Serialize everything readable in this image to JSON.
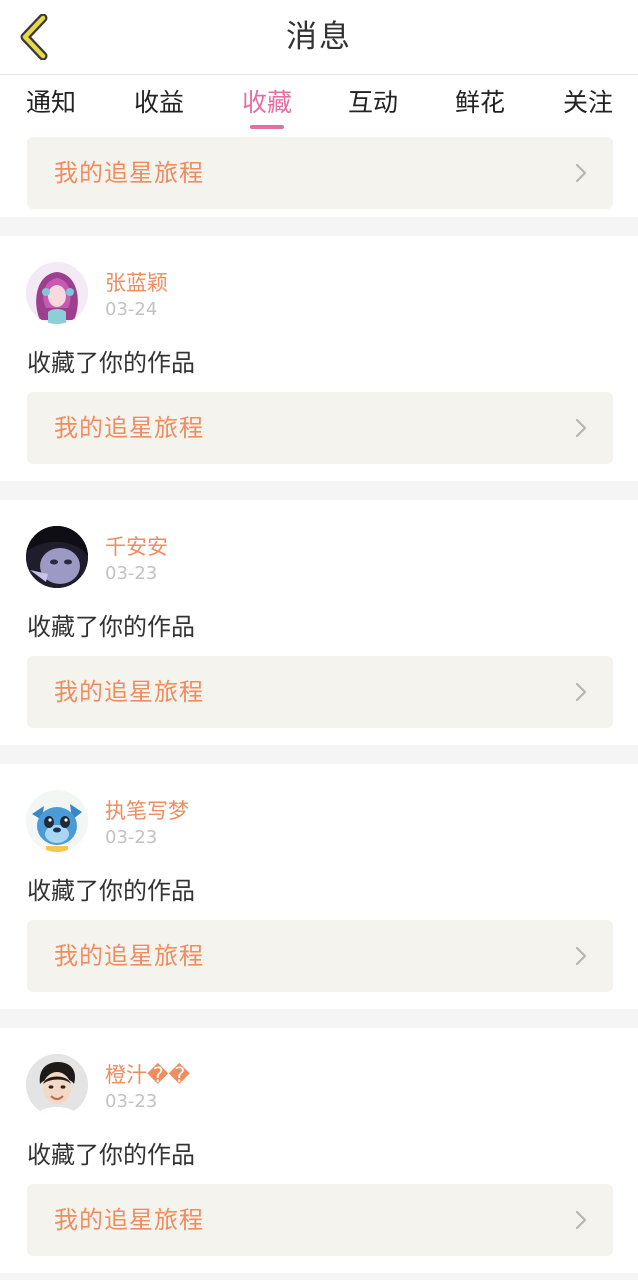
{
  "header": {
    "title": "消息",
    "back_icon": "chevron-left-icon",
    "accent_color": "#e8d94a"
  },
  "tabs": [
    {
      "label": "通知",
      "active": false
    },
    {
      "label": "收益",
      "active": false
    },
    {
      "label": "收藏",
      "active": true
    },
    {
      "label": "互动",
      "active": false
    },
    {
      "label": "鲜花",
      "active": false
    },
    {
      "label": "关注",
      "active": false
    }
  ],
  "active_color": "#e270a6",
  "top_card": {
    "link": "我的追星旅程"
  },
  "notifications": [
    {
      "name": "张蓝颖",
      "date": "03-24",
      "action": "收藏了你的作品",
      "link": "我的追星旅程",
      "avatar": "avatar-purple-haired-anime-girl"
    },
    {
      "name": "千安安",
      "date": "03-23",
      "action": "收藏了你的作品",
      "link": "我的追星旅程",
      "avatar": "avatar-dark-photo-girl"
    },
    {
      "name": "执笔写梦",
      "date": "03-23",
      "action": "收藏了你的作品",
      "link": "我的追星旅程",
      "avatar": "avatar-blue-cartoon-creature"
    },
    {
      "name": "橙汁��",
      "date": "03-23",
      "action": "收藏了你的作品",
      "link": "我的追星旅程",
      "avatar": "avatar-boy-photo"
    }
  ]
}
